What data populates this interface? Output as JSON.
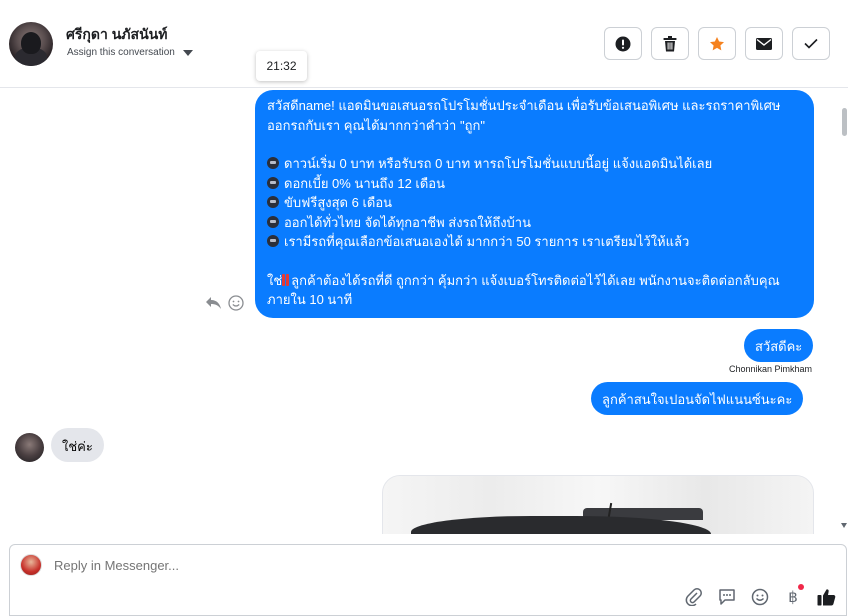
{
  "header": {
    "contact_name": "ศรีกุดา นภัสนันท์",
    "assign_label": "Assign this conversation",
    "actions": [
      {
        "name": "report-button",
        "icon": "exclamation-circle-icon"
      },
      {
        "name": "delete-button",
        "icon": "trash-icon"
      },
      {
        "name": "star-button",
        "icon": "star-icon"
      },
      {
        "name": "mark-unread-button",
        "icon": "envelope-icon"
      },
      {
        "name": "done-button",
        "icon": "check-icon"
      }
    ]
  },
  "tooltip": {
    "time": "21:32"
  },
  "messages": {
    "promo": {
      "line1": "สวัสดีname! แอดมินขอเสนอรถโปรโมชั่นประจำเดือน เพื่อรับข้อเสนอพิเศษ และรถราคาพิเศษ ออกรถกับเรา คุณได้มากกว่าคำว่า \"ถูก\"",
      "bullets": [
        "ดาวน์เริ่ม 0 บาท หรือรับรถ 0 บาท หารถโปรโมชั่นแบบนี้อยู่ แจ้งแอดมินได้เลย",
        "ดอกเบี้ย 0% นานถึง 12 เดือน",
        "ขับฟรีสูงสุด 6 เดือน",
        "ออกได้ทั่วไทย จัดได้ทุกอาชีพ ส่งรถให้ถึงบ้าน",
        "เรามีรถที่คุณเลือกข้อเสนอเองได้ มากกว่า 50 รายการ เราเตรียมไว้ให้แล้ว"
      ],
      "closing_prefix": "ใช่",
      "closing": "ลูกค้าต้องได้รถที่ดี ถูกกว่า คุ้มกว่า แจ้งเบอร์โทรติดต่อไว้ได้เลย พนักงานจะติดต่อกลับคุณภายใน 10 นาที"
    },
    "greeting": "สวัสดีคะ",
    "sender_name": "Chonnikan Pimkham",
    "interest": "ลูกค้าสนใจเปอนจัดไฟแนนซ์นะคะ",
    "customer_reply": "ใช่ค่ะ"
  },
  "composer": {
    "placeholder": "Reply in Messenger...",
    "tools": [
      "paperclip-icon",
      "chat-icon",
      "emoji-icon",
      "baht-icon",
      "thumbs-up-icon"
    ]
  },
  "colors": {
    "outgoing_bubble": "#0a7cff",
    "incoming_bubble": "#e4e6eb",
    "star_accent": "#f5821f",
    "notification_dot": "#f02849"
  }
}
